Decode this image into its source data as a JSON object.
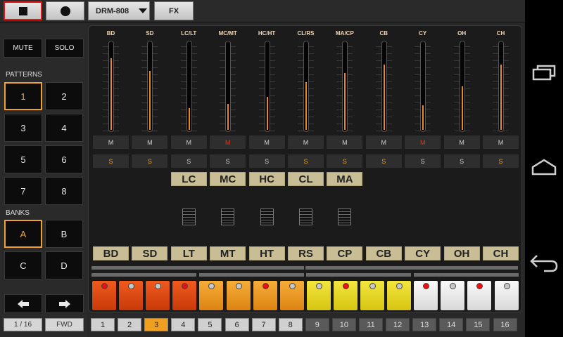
{
  "toolbar": {
    "stop_icon": "stop-icon",
    "record_icon": "record-icon",
    "kit_label": "DRM-808",
    "fx_label": "FX"
  },
  "left": {
    "mute_label": "MUTE",
    "solo_label": "SOLO",
    "patterns_label": "PATTERNS",
    "patterns": [
      "1",
      "2",
      "3",
      "4",
      "5",
      "6",
      "7",
      "8"
    ],
    "selected_pattern": "1",
    "banks_label": "BANKS",
    "banks": [
      "A",
      "B",
      "C",
      "D"
    ],
    "selected_bank": "A",
    "prev_icon": "arrow-left-icon",
    "next_icon": "arrow-right-icon",
    "page_indicator": "1 / 16",
    "direction_label": "FWD"
  },
  "channels": [
    {
      "name": "BD",
      "level": 0.82,
      "mute": "M",
      "mute_active": false,
      "solo": "S",
      "solo_active": true,
      "tag": "BD"
    },
    {
      "name": "SD",
      "level": 0.68,
      "mute": "M",
      "mute_active": false,
      "solo": "S",
      "solo_active": true,
      "tag": "SD"
    },
    {
      "name": "LC/LT",
      "level": 0.25,
      "mute": "M",
      "mute_active": false,
      "solo": "S",
      "solo_active": false,
      "lo_tag": "LC",
      "tag": "LT"
    },
    {
      "name": "MC/MT",
      "level": 0.3,
      "mute": "M",
      "mute_active": true,
      "solo": "S",
      "solo_active": false,
      "lo_tag": "MC",
      "tag": "MT"
    },
    {
      "name": "HC/HT",
      "level": 0.38,
      "mute": "M",
      "mute_active": false,
      "solo": "S",
      "solo_active": false,
      "lo_tag": "HC",
      "tag": "HT"
    },
    {
      "name": "CL/RS",
      "level": 0.55,
      "mute": "M",
      "mute_active": false,
      "solo": "S",
      "solo_active": true,
      "lo_tag": "CL",
      "tag": "RS"
    },
    {
      "name": "MA/CP",
      "level": 0.65,
      "mute": "M",
      "mute_active": false,
      "solo": "S",
      "solo_active": true,
      "lo_tag": "MA",
      "tag": "CP"
    },
    {
      "name": "CB",
      "level": 0.75,
      "mute": "M",
      "mute_active": false,
      "solo": "S",
      "solo_active": true,
      "tag": "CB"
    },
    {
      "name": "CY",
      "level": 0.28,
      "mute": "M",
      "mute_active": true,
      "solo": "S",
      "solo_active": false,
      "tag": "CY"
    },
    {
      "name": "OH",
      "level": 0.5,
      "mute": "M",
      "mute_active": false,
      "solo": "S",
      "solo_active": false,
      "tag": "OH"
    },
    {
      "name": "CH",
      "level": 0.75,
      "mute": "M",
      "mute_active": false,
      "solo": "S",
      "solo_active": true,
      "tag": "CH"
    }
  ],
  "steps": [
    {
      "num": "1",
      "color": "red",
      "led": "on"
    },
    {
      "num": "2",
      "color": "red",
      "led": "off"
    },
    {
      "num": "3",
      "color": "red",
      "led": "off"
    },
    {
      "num": "4",
      "color": "red",
      "led": "on"
    },
    {
      "num": "5",
      "color": "orange",
      "led": "off"
    },
    {
      "num": "6",
      "color": "orange",
      "led": "off"
    },
    {
      "num": "7",
      "color": "orange",
      "led": "on"
    },
    {
      "num": "8",
      "color": "orange",
      "led": "off"
    },
    {
      "num": "9",
      "color": "yellow",
      "led": "off"
    },
    {
      "num": "10",
      "color": "yellow",
      "led": "on"
    },
    {
      "num": "11",
      "color": "yellow",
      "led": "off"
    },
    {
      "num": "12",
      "color": "yellow",
      "led": "off"
    },
    {
      "num": "13",
      "color": "white",
      "led": "on"
    },
    {
      "num": "14",
      "color": "white",
      "led": "off"
    },
    {
      "num": "15",
      "color": "white",
      "led": "on"
    },
    {
      "num": "16",
      "color": "white",
      "led": "off"
    }
  ],
  "current_step": "3",
  "navbar": {
    "recents_icon": "recent-apps-icon",
    "home_icon": "home-icon",
    "back_icon": "back-icon"
  },
  "colors": {
    "accent": "#f0a020",
    "red_step": "#e24a14",
    "orange_step": "#ec9a28",
    "yellow_step": "#e6d828",
    "white_step": "#eeeeee",
    "tag_bg": "#c8bd95"
  }
}
